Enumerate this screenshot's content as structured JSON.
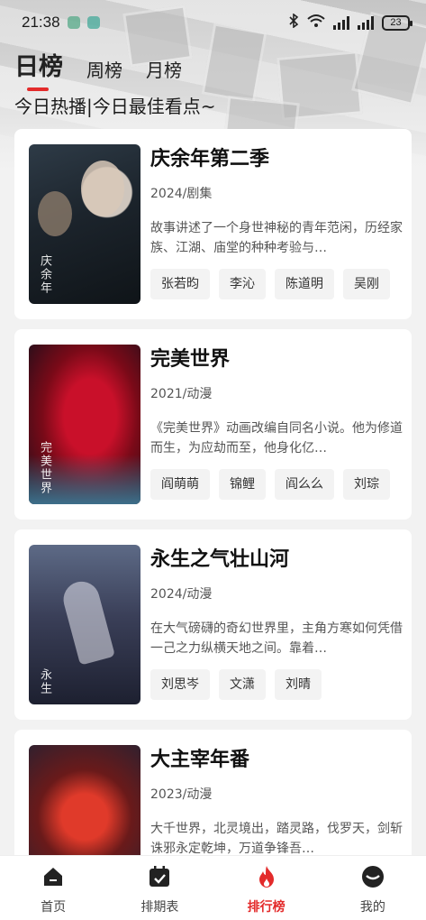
{
  "status_bar": {
    "time": "21:38",
    "battery": "23"
  },
  "tabs": [
    {
      "label": "日榜",
      "active": true
    },
    {
      "label": "周榜",
      "active": false
    },
    {
      "label": "月榜",
      "active": false
    }
  ],
  "subtitle": "今日热播|今日最佳看点~",
  "items": [
    {
      "title": "庆余年第二季",
      "meta": "2024/剧集",
      "desc": "故事讲述了一个身世神秘的青年范闲，历经家族、江湖、庙堂的种种考验与…",
      "cast": [
        "张若昀",
        "李沁",
        "陈道明",
        "吴刚"
      ],
      "poster_caption": "庆余年"
    },
    {
      "title": "完美世界",
      "meta": "2021/动漫",
      "desc": "《完美世界》动画改编自同名小说。他为修道而生，为应劫而至，他身化亿…",
      "cast": [
        "阎萌萌",
        "锦鲤",
        "阎么么",
        "刘琮"
      ],
      "poster_caption": "完美世界"
    },
    {
      "title": "永生之气壮山河",
      "meta": "2024/动漫",
      "desc": "在大气磅礴的奇幻世界里，主角方寒如何凭借一己之力纵横天地之间。靠着…",
      "cast": [
        "刘思岑",
        "文潇",
        "刘晴"
      ],
      "poster_caption": "永生"
    },
    {
      "title": "大主宰年番",
      "meta": "2023/动漫",
      "desc": "大千世界，北灵境出，踏灵路，伐罗天，剑斩诛邪永定乾坤，万道争锋吾…",
      "cast": [],
      "poster_caption": ""
    }
  ],
  "bottom_nav": [
    {
      "label": "首页",
      "icon": "home-icon",
      "active": false
    },
    {
      "label": "排期表",
      "icon": "calendar-check-icon",
      "active": false
    },
    {
      "label": "排行榜",
      "icon": "flame-icon",
      "active": true
    },
    {
      "label": "我的",
      "icon": "profile-icon",
      "active": false
    }
  ],
  "colors": {
    "accent": "#e32b2b",
    "card": "#ffffff",
    "chip": "#f3f3f3"
  }
}
